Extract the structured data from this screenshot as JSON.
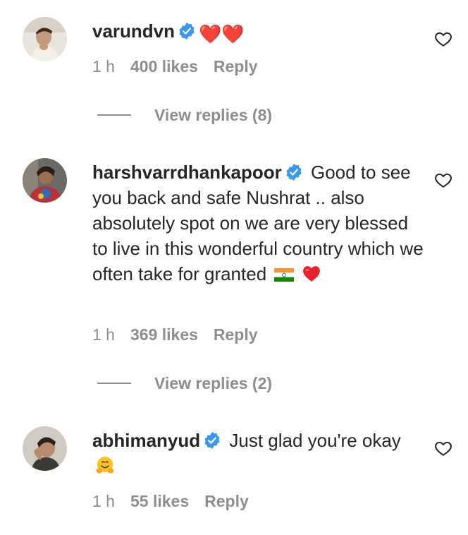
{
  "comments": [
    {
      "username": "varundvn",
      "text": "",
      "emoji": "❤️❤️",
      "time": "1 h",
      "likes": "400 likes",
      "reply": "Reply",
      "view_replies": "View replies (8)"
    },
    {
      "username": "harshvarrdhankapoor",
      "text": "Good to see you back and safe Nushrat .. also absolutely spot on we are very blessed to live in this wonderful country which we often take for granted",
      "emoji_flag": "🇮🇳",
      "emoji_heart": "❤️",
      "time": "1 h",
      "likes": "369 likes",
      "reply": "Reply",
      "view_replies": "View replies (2)"
    },
    {
      "username": "abhimanyud",
      "text": "Just glad you're okay",
      "emoji": "🤗",
      "time": "1 h",
      "likes": "55 likes",
      "reply": "Reply"
    }
  ],
  "icons": {
    "verified": "verified-badge-icon",
    "like": "heart-outline-icon"
  },
  "colors": {
    "text": "#262626",
    "secondary": "#8e8e8e",
    "verified": "#3897f0",
    "heart": "#ed4956"
  }
}
